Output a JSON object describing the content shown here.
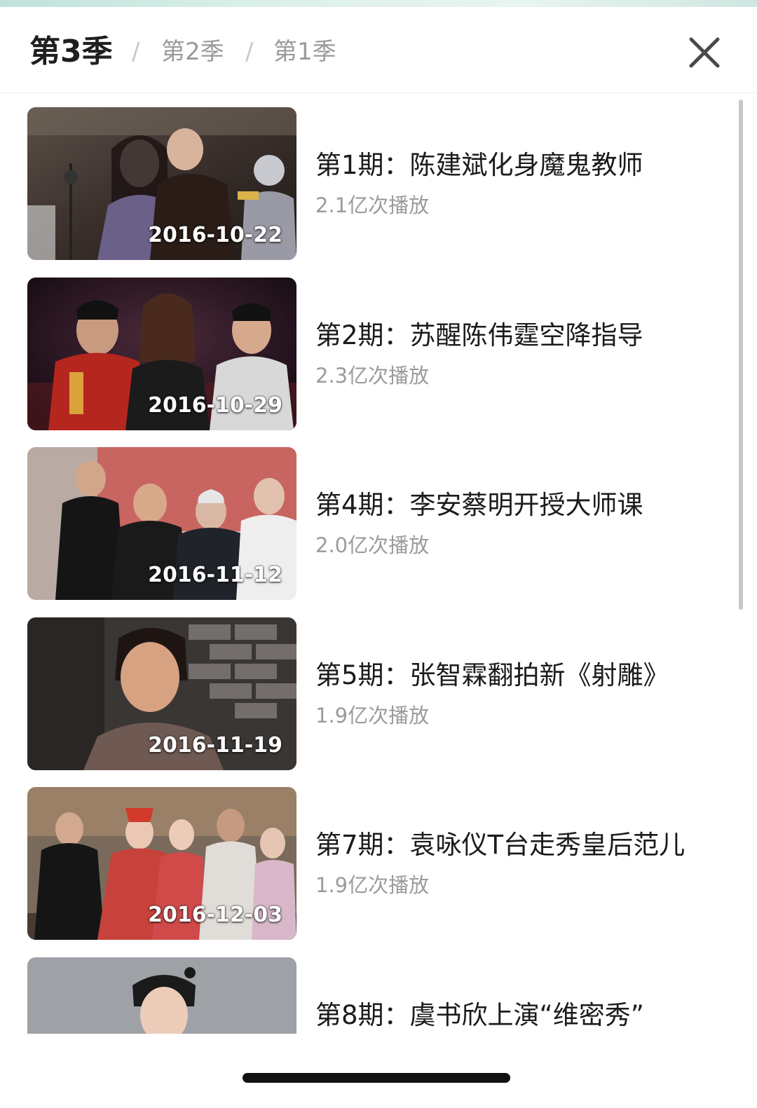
{
  "header": {
    "active_tab": "第3季",
    "tabs": [
      "第2季",
      "第1季"
    ],
    "separator": "/"
  },
  "episodes": [
    {
      "title": "第1期：陈建斌化身魔鬼教师",
      "plays": "2.1亿次播放",
      "date": "2016-10-22"
    },
    {
      "title": "第2期：苏醒陈伟霆空降指导",
      "plays": "2.3亿次播放",
      "date": "2016-10-29"
    },
    {
      "title": "第4期：李安蔡明开授大师课",
      "plays": "2.0亿次播放",
      "date": "2016-11-12"
    },
    {
      "title": "第5期：张智霖翻拍新《射雕》",
      "plays": "1.9亿次播放",
      "date": "2016-11-19"
    },
    {
      "title": "第7期：袁咏仪T台走秀皇后范儿",
      "plays": "1.9亿次播放",
      "date": "2016-12-03"
    },
    {
      "title": "第8期：虞书欣上演“维密秀”",
      "plays": "",
      "date": ""
    }
  ],
  "icons": {
    "close": "close-icon"
  }
}
